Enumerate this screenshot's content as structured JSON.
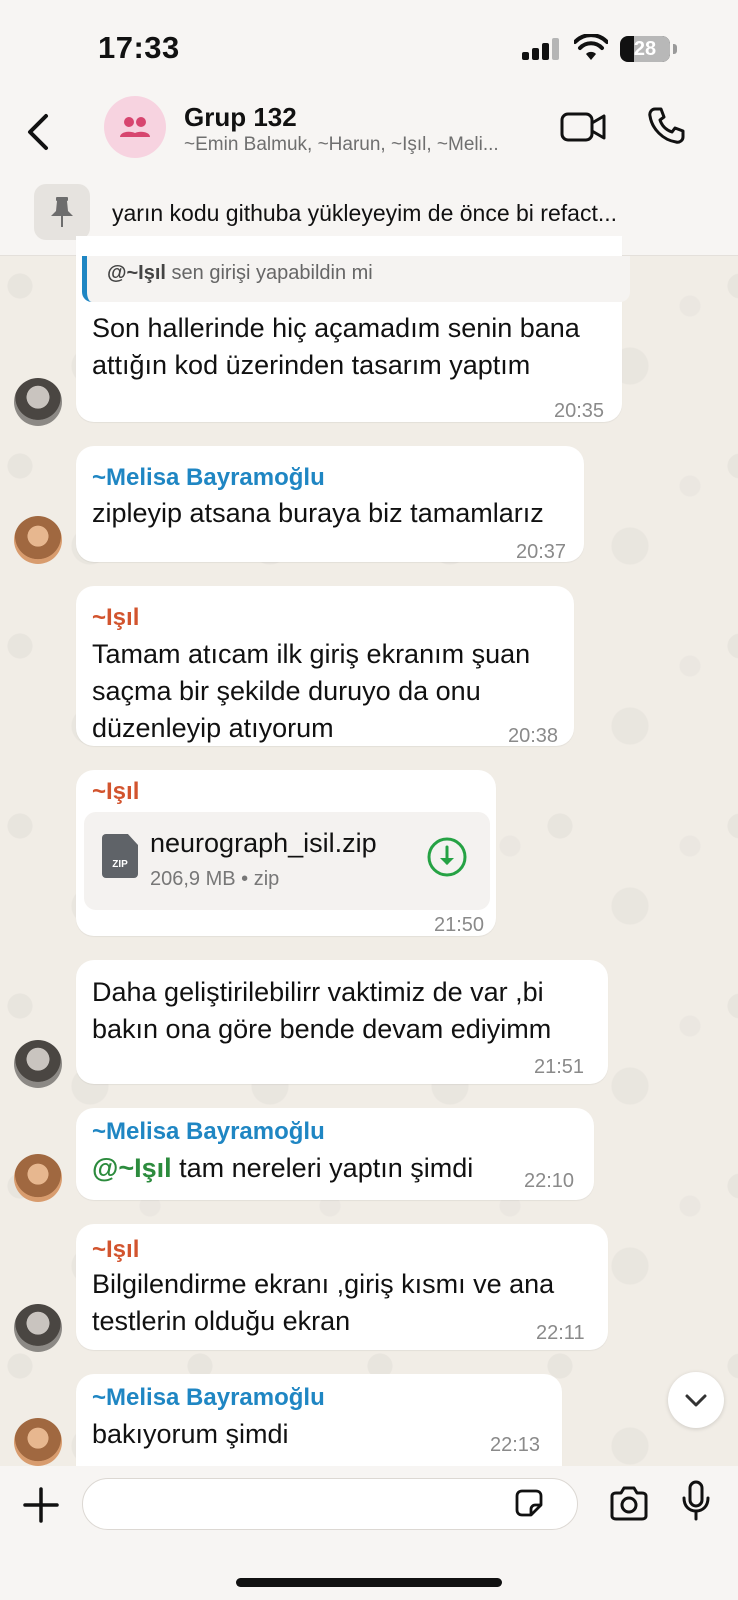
{
  "status": {
    "time": "17:33",
    "battery": "28"
  },
  "header": {
    "title": "Grup 132",
    "members": "~Emin Balmuk, ~Harun, ~Işıl, ~Meli..."
  },
  "pinned": {
    "text": "yarın kodu githuba yükleyeyim de önce bi refact..."
  },
  "messages": [
    {
      "quote_sender": "@~Işıl",
      "quote_text": " sen girişi yapabildin mi",
      "text_l1": "Son hallerinde hiç açamadım senin bana",
      "text_l2": "attığın kod üzerinden tasarım yaptım",
      "time": "20:35"
    },
    {
      "sender": "~Melisa Bayramoğlu",
      "text": "zipleyip atsana buraya biz tamamlarız",
      "time": "20:37"
    },
    {
      "sender": "~Işıl",
      "text_l1": "Tamam atıcam ilk giriş ekranım şuan",
      "text_l2": "saçma bir şekilde duruyo da onu",
      "text_l3": "düzenleyip atıyorum",
      "time": "20:38"
    },
    {
      "sender": "~Işıl",
      "file_name": "neurograph_isil.zip",
      "file_meta": "206,9 MB • zip",
      "file_badge": "ZIP",
      "time": "21:50"
    },
    {
      "text_l1": "Daha geliştirilebilirr vaktimiz de var ,bi",
      "text_l2": "bakın ona göre bende devam ediyimm",
      "time": "21:51"
    },
    {
      "sender": "~Melisa Bayramoğlu",
      "mention": "@~Işıl",
      "text": " tam nereleri yaptın şimdi",
      "time": "22:10"
    },
    {
      "sender": "~Işıl",
      "text_l1": "Bilgilendirme ekranı ,giriş kısmı ve ana",
      "text_l2": "testlerin olduğu ekran",
      "time": "22:11"
    },
    {
      "sender": "~Melisa Bayramoğlu",
      "text": "bakıyorum şimdi",
      "time": "22:13"
    }
  ],
  "composer": {
    "placeholder": ""
  },
  "colors": {
    "melisa": "#1f86c3",
    "isil": "#d2542e",
    "mention": "#2c8b3d",
    "download": "#25a244"
  }
}
